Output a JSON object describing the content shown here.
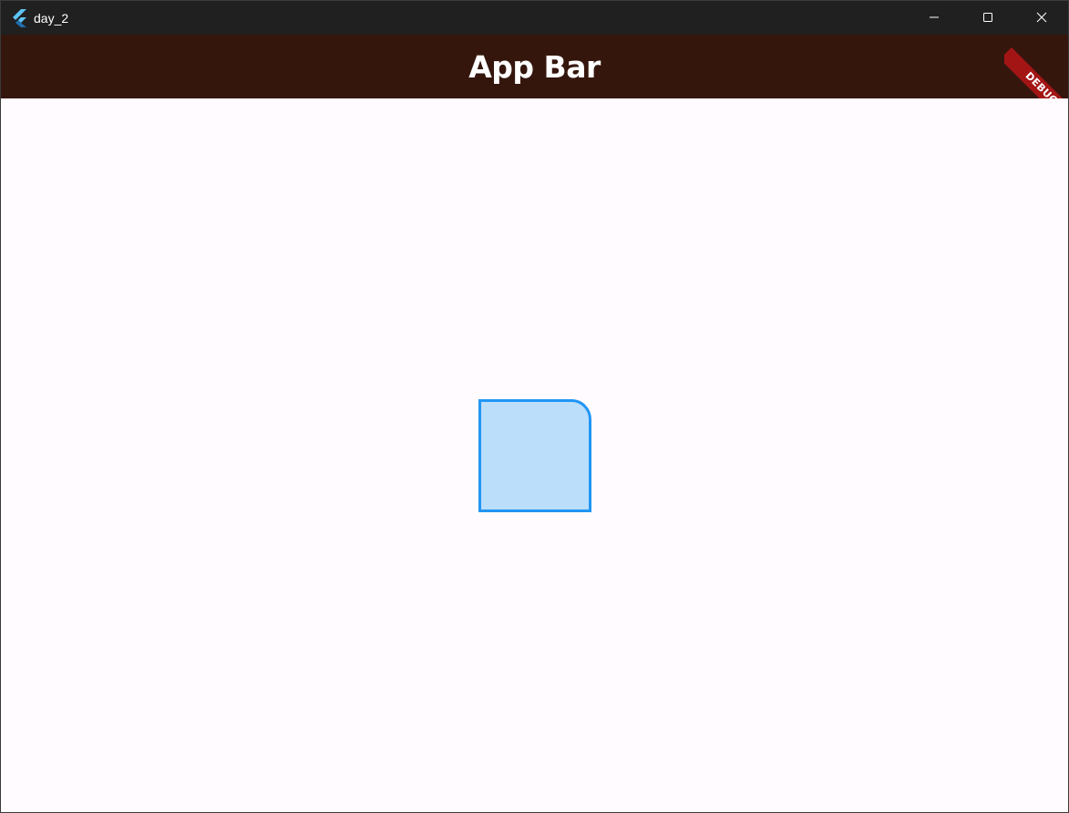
{
  "window": {
    "title": "day_2",
    "icon": "flutter-logo-icon",
    "controls": [
      "minimize-icon",
      "maximize-icon",
      "close-icon"
    ]
  },
  "app_bar": {
    "title": "App Bar",
    "background_color": "#35160d",
    "title_color": "#ffffff"
  },
  "debug_banner": {
    "label": "DEBUG",
    "color": "#a31515"
  },
  "body": {
    "background_color": "#fffbfe",
    "container": {
      "fill_color": "#bbdefb",
      "border_color": "#2196f3"
    }
  }
}
